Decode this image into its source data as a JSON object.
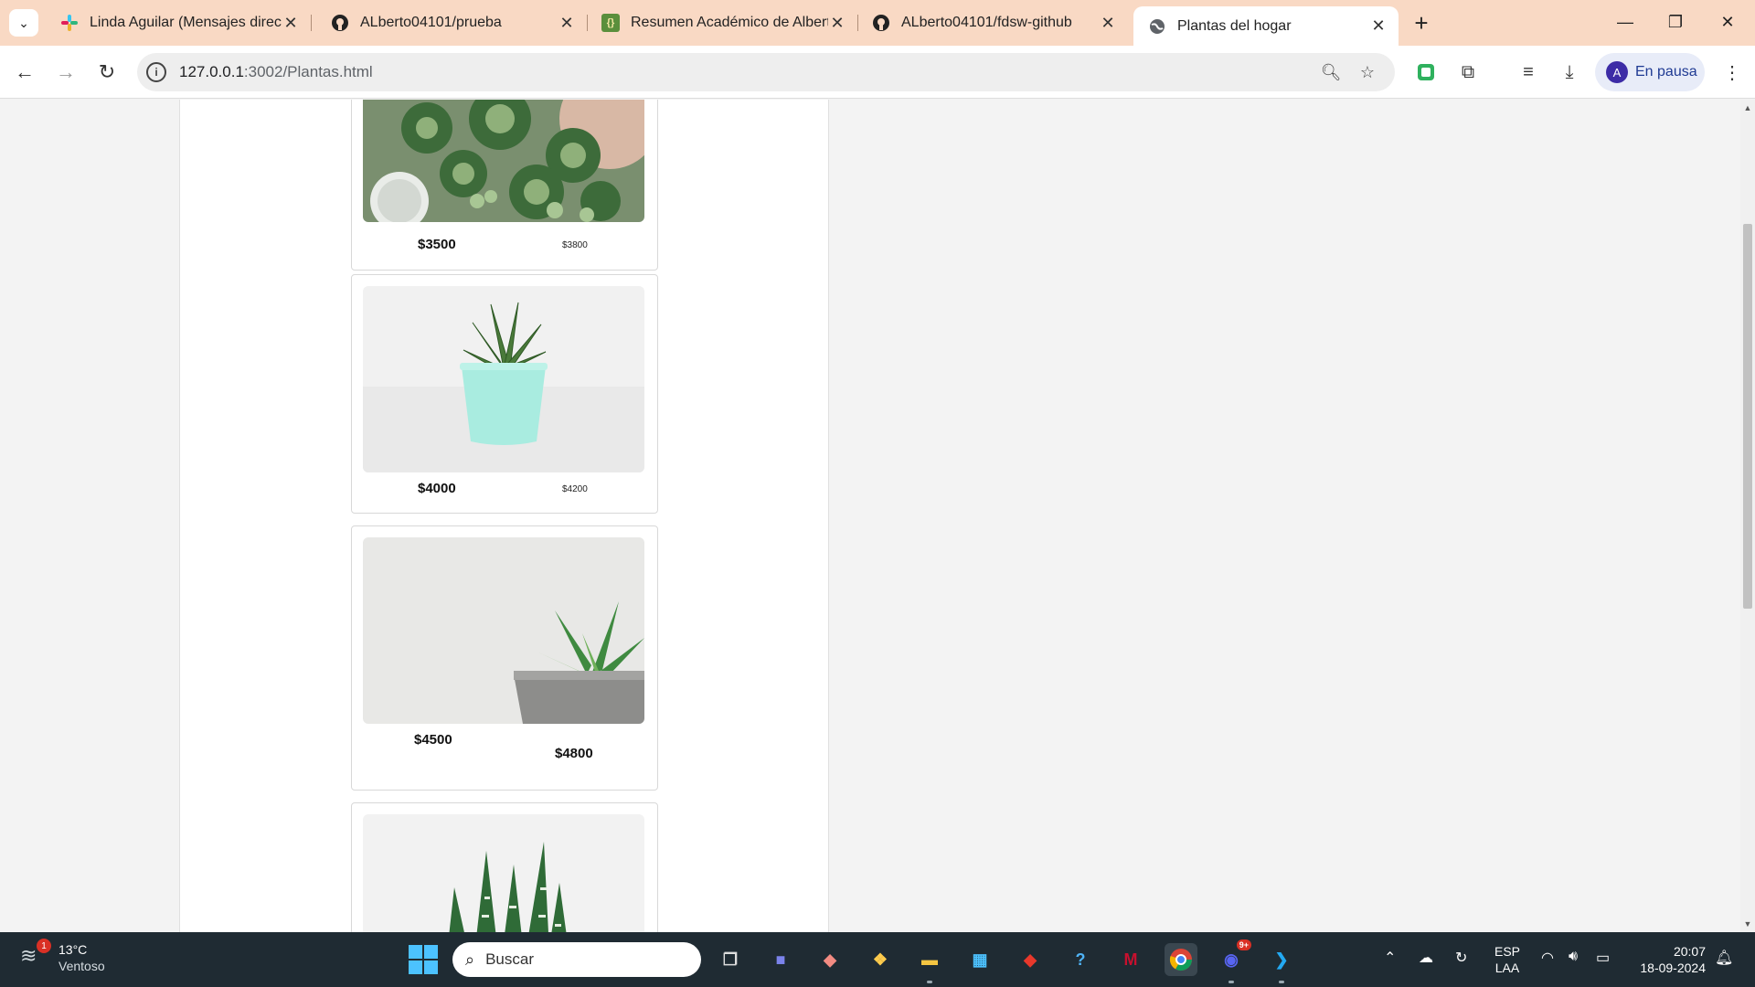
{
  "browser": {
    "tabs": [
      {
        "title": "Linda Aguilar (Mensajes directos",
        "icon": "slack-icon"
      },
      {
        "title": "ALberto04101/prueba",
        "icon": "github-icon"
      },
      {
        "title": "Resumen Académico de Alberto",
        "icon": "json-file-icon"
      },
      {
        "title": "ALberto04101/fdsw-github",
        "icon": "github-icon"
      },
      {
        "title": "Plantas del hogar",
        "icon": "globe-icon"
      }
    ],
    "url_host": "127.0.0.1",
    "url_path": ":3002/Plantas.html",
    "profile_initial": "A",
    "profile_label": "En pausa"
  },
  "products": [
    {
      "price": "$3500",
      "old_price": "$3800",
      "image": "succulents-arrangement"
    },
    {
      "price": "$4000",
      "old_price": "$4200",
      "image": "haworthia-teal-pot"
    },
    {
      "price": "$4500",
      "old_price": "$4800",
      "image": "echeveria-concrete-pot"
    },
    {
      "price": "",
      "old_price": "",
      "image": "zebra-haworthia"
    }
  ],
  "taskbar": {
    "weather_temp": "13°C",
    "weather_desc": "Ventoso",
    "weather_badge": "1",
    "search_placeholder": "Buscar",
    "lang_top": "ESP",
    "lang_bottom": "LAA",
    "time": "20:07",
    "date": "18-09-2024",
    "discord_badge": "9+"
  },
  "colors": {
    "tabbar": "#f9d9c4",
    "taskbar": "#1f2b33",
    "accent": "#4cc2ff"
  }
}
